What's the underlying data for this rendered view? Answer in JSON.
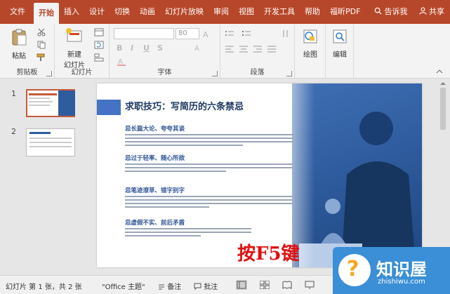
{
  "menu": {
    "tabs": [
      "文件",
      "开始",
      "插入",
      "设计",
      "切换",
      "动画",
      "幻灯片放映",
      "审阅",
      "视图",
      "开发工具",
      "帮助",
      "福昕PDF"
    ],
    "active_index": 1,
    "tell_me": "告诉我",
    "share": "共享"
  },
  "ribbon": {
    "clipboard": {
      "paste": "粘贴",
      "label": "剪贴板"
    },
    "slides": {
      "new_slide_line1": "新建",
      "new_slide_line2": "幻灯片",
      "label": "幻灯片"
    },
    "font": {
      "size": "80",
      "bold": "B",
      "italic": "I",
      "underline": "U",
      "strike": "S",
      "label": "字体"
    },
    "paragraph": {
      "label": "段落"
    },
    "drawing": {
      "label": "绘图"
    },
    "editing": {
      "label": "编辑"
    }
  },
  "thumbnails": [
    {
      "number": "1",
      "selected": true
    },
    {
      "number": "2",
      "selected": false
    }
  ],
  "slide": {
    "title": "求职技巧：写简历的六条禁忌",
    "sections": [
      "忌长篇大论、夸夸其谈",
      "忌过于轻率、随心所欲",
      "忌笔迹潦草、错字别字",
      "忌虚假不实、前后矛盾"
    ],
    "overlay_text": "按F5键"
  },
  "status": {
    "slide_info": "幻灯片 第 1 张，共 2 张",
    "theme": "\"Office 主题\"",
    "notes": "备注",
    "comments": "批注"
  },
  "watermark": {
    "title": "知识屋",
    "url": "zhishiwu.com"
  },
  "colors": {
    "accent": "#b7472a",
    "slide_blue": "#2f5c9e",
    "overlay_red": "#e01010",
    "watermark_blue": "#3a8fd6"
  }
}
